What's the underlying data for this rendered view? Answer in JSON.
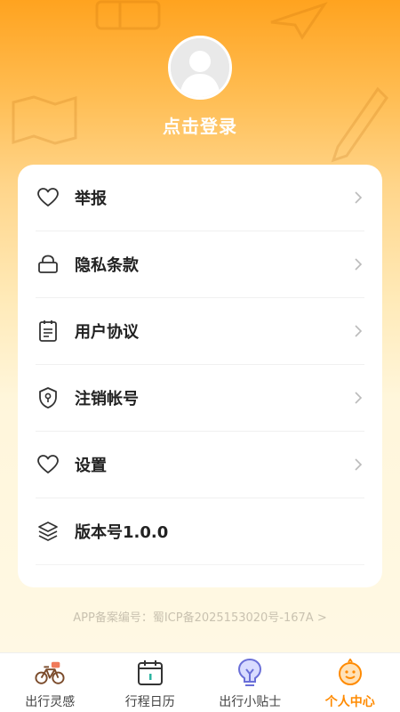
{
  "profile": {
    "login_label": "点击登录"
  },
  "menu": [
    {
      "label": "举报",
      "icon": "heart-icon"
    },
    {
      "label": "隐私条款",
      "icon": "lock-icon"
    },
    {
      "label": "用户协议",
      "icon": "document-icon"
    },
    {
      "label": "注销帐号",
      "icon": "shield-key-icon"
    },
    {
      "label": "设置",
      "icon": "heart-icon"
    },
    {
      "label": "版本号1.0.0",
      "icon": "layers-icon"
    }
  ],
  "footer": {
    "icp": "APP备案编号：蜀ICP备2025153020号-167A >"
  },
  "tabs": [
    {
      "label": "出行灵感",
      "icon": "bicycle-icon"
    },
    {
      "label": "行程日历",
      "icon": "calendar-icon"
    },
    {
      "label": "出行小贴士",
      "icon": "lightbulb-icon"
    },
    {
      "label": "个人中心",
      "icon": "smiley-icon"
    }
  ],
  "colors": {
    "accent": "#ff8a00",
    "header_top": "#ffa31f",
    "card": "#ffffff"
  }
}
